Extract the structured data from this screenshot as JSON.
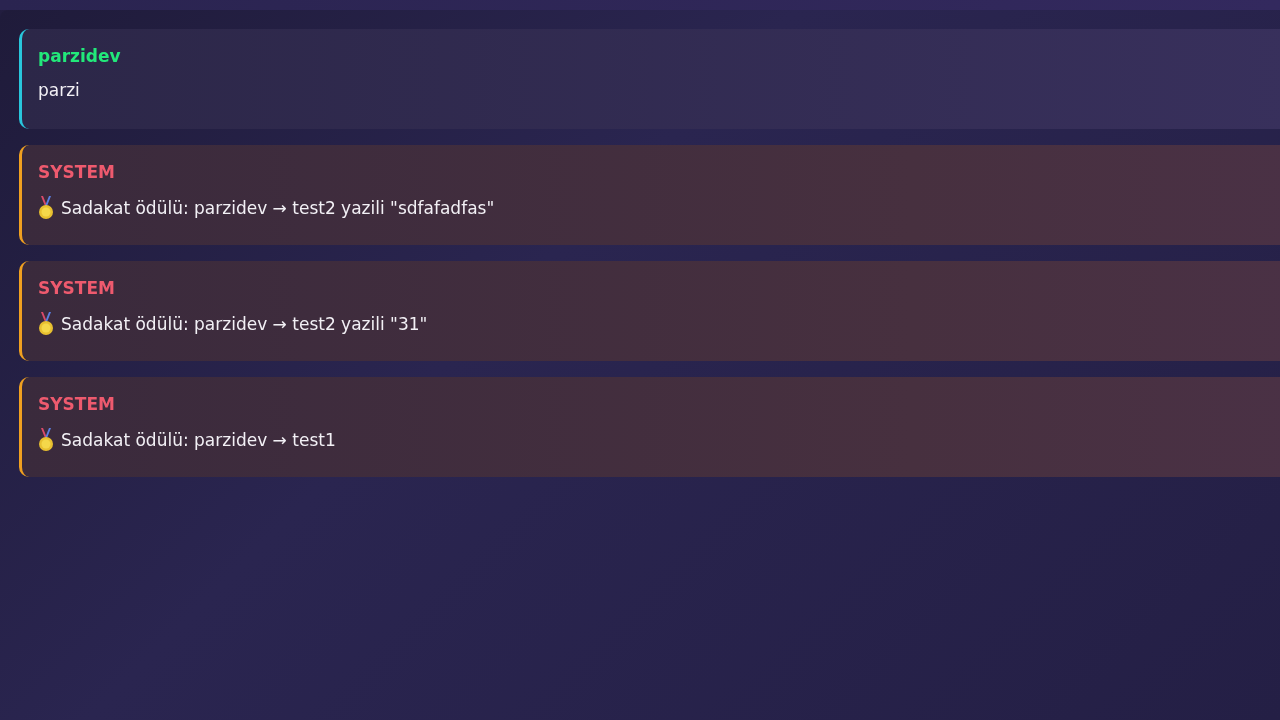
{
  "messages": [
    {
      "kind": "user",
      "author": "parzidev",
      "text": "parzi"
    },
    {
      "kind": "system",
      "author": "SYSTEM",
      "text": "Sadakat ödülü: parzidev → test2 yazili \"sdfafadfas\""
    },
    {
      "kind": "system",
      "author": "SYSTEM",
      "text": "Sadakat ödülü: parzidev → test2 yazili \"31\""
    },
    {
      "kind": "system",
      "author": "SYSTEM",
      "text": "Sadakat ödülü: parzidev → test1"
    }
  ]
}
